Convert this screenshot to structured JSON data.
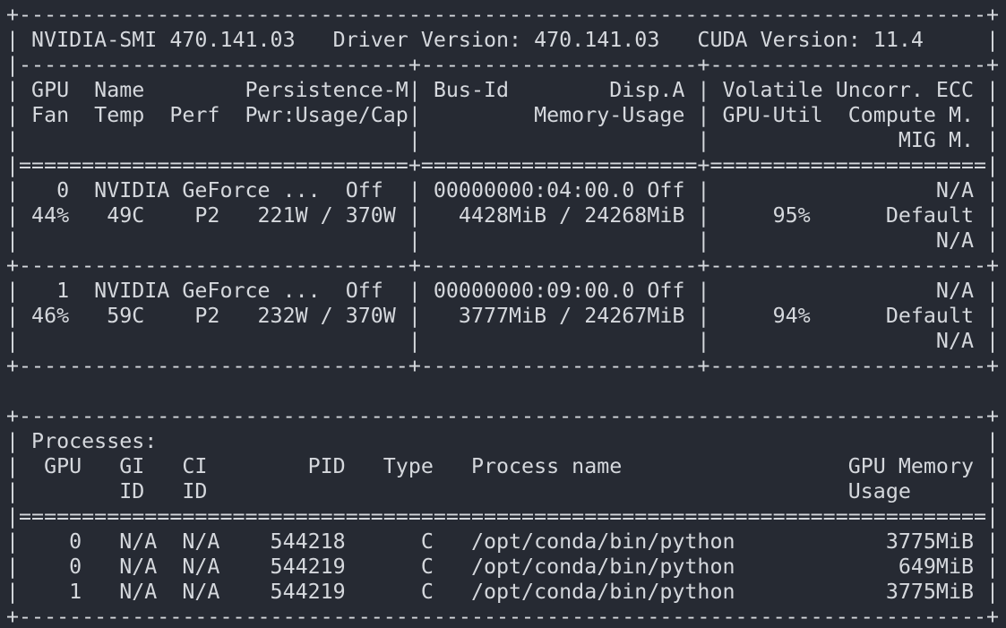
{
  "terminal": {
    "lines": [
      "+-----------------------------------------------------------------------------+",
      "| NVIDIA-SMI 470.141.03   Driver Version: 470.141.03   CUDA Version: 11.4     |",
      "|-------------------------------+----------------------+----------------------+",
      "| GPU  Name        Persistence-M| Bus-Id        Disp.A | Volatile Uncorr. ECC |",
      "| Fan  Temp  Perf  Pwr:Usage/Cap|         Memory-Usage | GPU-Util  Compute M. |",
      "|                               |                      |               MIG M. |",
      "|===============================+======================+======================|",
      "|   0  NVIDIA GeForce ...  Off  | 00000000:04:00.0 Off |                  N/A |",
      "| 44%   49C    P2   221W / 370W |   4428MiB / 24268MiB |     95%      Default |",
      "|                               |                      |                  N/A |",
      "+-------------------------------+----------------------+----------------------+",
      "|   1  NVIDIA GeForce ...  Off  | 00000000:09:00.0 Off |                  N/A |",
      "| 46%   59C    P2   232W / 370W |   3777MiB / 24267MiB |     94%      Default |",
      "|                               |                      |                  N/A |",
      "+-------------------------------+----------------------+----------------------+",
      "",
      "+-----------------------------------------------------------------------------+",
      "| Processes:                                                                  |",
      "|  GPU   GI   CI        PID   Type   Process name                  GPU Memory |",
      "|        ID   ID                                                   Usage      |",
      "|=============================================================================|",
      "|    0   N/A  N/A    544218      C   /opt/conda/bin/python            3775MiB |",
      "|    0   N/A  N/A    544219      C   /opt/conda/bin/python             649MiB |",
      "|    1   N/A  N/A    544219      C   /opt/conda/bin/python            3775MiB |",
      "+-----------------------------------------------------------------------------+"
    ]
  }
}
